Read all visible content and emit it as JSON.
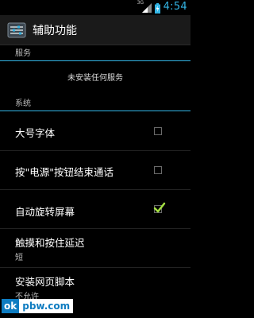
{
  "statusbar": {
    "network": "3G",
    "time": "4:54"
  },
  "actionbar": {
    "title": "辅助功能"
  },
  "sections": {
    "services": "服务",
    "system": "系统"
  },
  "services_empty": "未安装任何服务",
  "settings": [
    {
      "label": "大号字体",
      "checked": false
    },
    {
      "label": "按\"电源\"按钮结束通话",
      "checked": false
    },
    {
      "label": "自动旋转屏幕",
      "checked": true
    },
    {
      "label": "触摸和按住延迟",
      "summary": "短"
    },
    {
      "label": "安装网页脚本",
      "summary": "不允许"
    }
  ],
  "watermark": {
    "part1": "ok",
    "part2": "pbw.com"
  },
  "colors": {
    "accent": "#33b5e5",
    "check": "#a4e042"
  }
}
